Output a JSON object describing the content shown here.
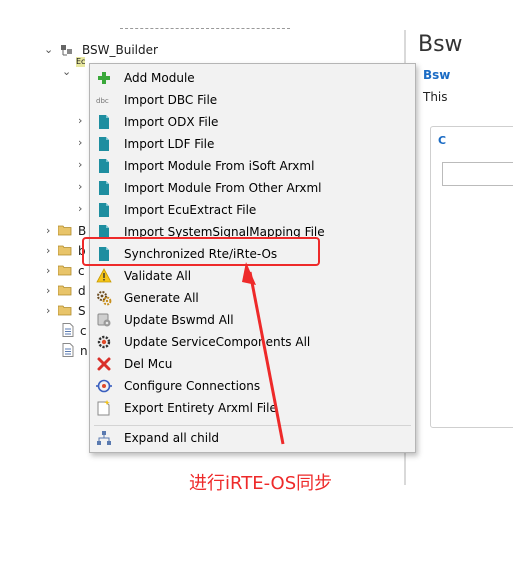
{
  "tree": {
    "root_label": "BSW_Builder",
    "child_label": "Ec",
    "folder_labels": [
      "B",
      "b",
      "c",
      "d",
      "S"
    ],
    "file_labels": [
      "c",
      "n"
    ]
  },
  "right_pane": {
    "title": "Bsw",
    "tab": "Bsw",
    "description": "This",
    "inner_tab": "C"
  },
  "context_menu": {
    "items": [
      {
        "label": "Add Module",
        "icon": "plus-icon"
      },
      {
        "label": "Import DBC File",
        "icon": "dbc-icon"
      },
      {
        "label": "Import ODX File",
        "icon": "import-file-icon"
      },
      {
        "label": "Import LDF File",
        "icon": "import-file-icon"
      },
      {
        "label": "Import Module From iSoft Arxml",
        "icon": "import-file-icon"
      },
      {
        "label": "Import Module From Other Arxml",
        "icon": "import-file-icon"
      },
      {
        "label": "Import EcuExtract File",
        "icon": "import-file-icon"
      },
      {
        "label": "Import SystemSignalMapping File",
        "icon": "import-file-icon"
      },
      {
        "label": "Synchronized Rte/iRte-Os",
        "icon": "import-file-icon"
      },
      {
        "label": "Validate All",
        "icon": "warning-icon"
      },
      {
        "label": "Generate All",
        "icon": "gears-icon"
      },
      {
        "label": "Update Bswmd All",
        "icon": "update-disk-icon"
      },
      {
        "label": "Update ServiceComponents All",
        "icon": "service-gear-icon"
      },
      {
        "label": "Del Mcu",
        "icon": "delete-x-icon"
      },
      {
        "label": "Configure Connections",
        "icon": "connection-icon"
      },
      {
        "label": "Export Entirety Arxml File",
        "icon": "export-file-icon"
      },
      {
        "label": "Expand all child",
        "icon": "tree-expand-icon"
      }
    ]
  },
  "annotation": {
    "text": "进行iRTE-OS同步",
    "color": "#ee2a2a"
  },
  "colors": {
    "menu_bg": "#f2f2f2",
    "file_icon_teal": "#1e8ea0",
    "accent_blue": "#1a6bc4"
  }
}
